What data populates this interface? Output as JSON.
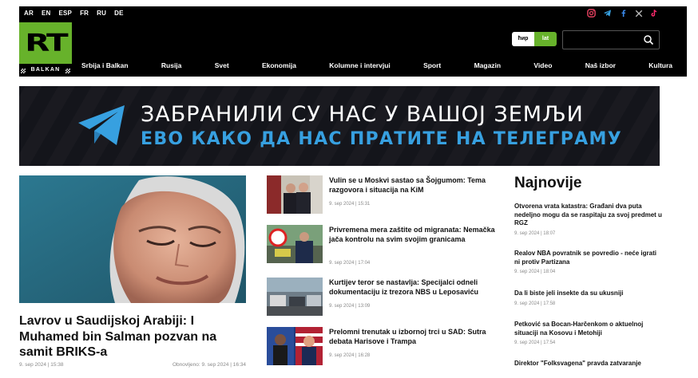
{
  "header": {
    "languages": [
      "AR",
      "EN",
      "ESP",
      "FR",
      "RU",
      "DE"
    ],
    "logo_text": "RT",
    "logo_sub": "BALKAN",
    "script_toggle": {
      "cyrillic": "ћир",
      "latin": "lat"
    },
    "search_placeholder": "",
    "nav": [
      "Srbija i Balkan",
      "Rusija",
      "Svet",
      "Ekonomija",
      "Kolumne i intervjui",
      "Sport",
      "Magazin",
      "Video",
      "Naš izbor",
      "Kultura"
    ],
    "social_icons": [
      "instagram-icon",
      "telegram-icon",
      "facebook-icon",
      "x-icon",
      "tiktok-icon"
    ]
  },
  "banner": {
    "line1": "ЗАБРАНИЛИ СУ НАС У ВАШОЈ ЗЕМЉИ",
    "line2": "ЕВО КАКО ДА НАС ПРАТИТЕ НА ТЕЛЕГРАМУ"
  },
  "main_article": {
    "title": "Lavrov u Saudijskoj Arabiji: I Muhamed bin Salman pozvan na samit BRIKS-a",
    "date": "9. sep 2024 | 15:38",
    "updated": "Obnovljeno: 9. sep 2024 | 16:34"
  },
  "middle_list": [
    {
      "title": "Vulin se u Moskvi sastao sa Šojgumom: Tema razgovora i situacija na KiM",
      "date": "9. sep 2024 | 15:31"
    },
    {
      "title": "Privremena mera zaštite od migranata: Nemačka jača kontrolu na svim svojim granicama",
      "date": "9. sep 2024 | 17:04"
    },
    {
      "title": "Kurtijev teror se nastavlja: Specijalci odneli dokumentaciju iz trezora NBS u Leposaviću",
      "date": "9. sep 2024 | 13:09"
    },
    {
      "title": "Prelomni trenutak u izbornoj trci u SAD: Sutra debata Harisove i Trampa",
      "date": "9. sep 2024 | 16:28"
    }
  ],
  "latest": {
    "heading": "Najnovije",
    "items": [
      {
        "title": "Otvorena vrata katastra: Građani dva puta nedeljno mogu da se raspitaju za svoj predmet u RGZ",
        "date": "9. sep 2024 | 18:07"
      },
      {
        "title": "Realov NBA povratnik se povredio - neće igrati ni protiv Partizana",
        "date": "9. sep 2024 | 18:04"
      },
      {
        "title": "Da li biste jeli insekte da su ukusniji",
        "date": "9. sep 2024 | 17:58"
      },
      {
        "title": "Petković sa Bocan-Harčenkom o aktuelnoj situaciji na Kosovu i Metohiji",
        "date": "9. sep 2024 | 17:54"
      },
      {
        "title": "Direktor \"Folksvagena\" pravda zatvaranje",
        "date": ""
      }
    ]
  },
  "colors": {
    "brand_green": "#67b22b",
    "telegram_blue": "#37a0e0",
    "header_bg": "#000000"
  }
}
